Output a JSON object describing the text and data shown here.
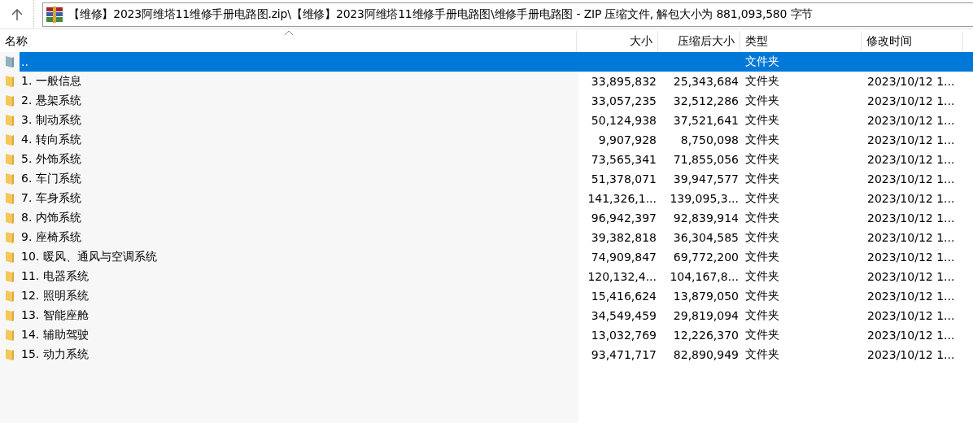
{
  "address_bar": {
    "path": "【维修】2023阿维塔11维修手册电路图.zip\\【维修】2023阿维塔11维修手册电路图\\维修手册电路图 - ZIP 压缩文件, 解包大小为 881,093,580 字节"
  },
  "table": {
    "columns": [
      {
        "label": "名称",
        "sorted": true
      },
      {
        "label": "大小",
        "sorted": false
      },
      {
        "label": "压缩后大小",
        "sorted": false
      },
      {
        "label": "类型",
        "sorted": false
      },
      {
        "label": "修改时间",
        "sorted": false
      }
    ],
    "rows": [
      {
        "kind": "parent",
        "name": "..",
        "type": "文件夹",
        "selected": true
      },
      {
        "kind": "folder",
        "name": "1. 一般信息",
        "size": "33,895,832",
        "packed": "25,343,684",
        "type": "文件夹",
        "modified": "2023/10/12 1...",
        "selected": false
      },
      {
        "kind": "folder",
        "name": "2. 悬架系统",
        "size": "33,057,235",
        "packed": "32,512,286",
        "type": "文件夹",
        "modified": "2023/10/12 1...",
        "selected": false
      },
      {
        "kind": "folder",
        "name": "3. 制动系统",
        "size": "50,124,938",
        "packed": "37,521,641",
        "type": "文件夹",
        "modified": "2023/10/12 1...",
        "selected": false
      },
      {
        "kind": "folder",
        "name": "4. 转向系统",
        "size": "9,907,928",
        "packed": "8,750,098",
        "type": "文件夹",
        "modified": "2023/10/12 1...",
        "selected": false
      },
      {
        "kind": "folder",
        "name": "5. 外饰系统",
        "size": "73,565,341",
        "packed": "71,855,056",
        "type": "文件夹",
        "modified": "2023/10/12 1...",
        "selected": false
      },
      {
        "kind": "folder",
        "name": "6. 车门系统",
        "size": "51,378,071",
        "packed": "39,947,577",
        "type": "文件夹",
        "modified": "2023/10/12 1...",
        "selected": false
      },
      {
        "kind": "folder",
        "name": "7. 车身系统",
        "size": "141,326,1...",
        "packed": "139,095,3...",
        "type": "文件夹",
        "modified": "2023/10/12 1...",
        "selected": false
      },
      {
        "kind": "folder",
        "name": "8. 内饰系统",
        "size": "96,942,397",
        "packed": "92,839,914",
        "type": "文件夹",
        "modified": "2023/10/12 1...",
        "selected": false
      },
      {
        "kind": "folder",
        "name": "9. 座椅系统",
        "size": "39,382,818",
        "packed": "36,304,585",
        "type": "文件夹",
        "modified": "2023/10/12 1...",
        "selected": false
      },
      {
        "kind": "folder",
        "name": "10. 暖风、通风与空调系统",
        "size": "74,909,847",
        "packed": "69,772,200",
        "type": "文件夹",
        "modified": "2023/10/12 1...",
        "selected": false
      },
      {
        "kind": "folder",
        "name": "11. 电器系统",
        "size": "120,132,4...",
        "packed": "104,167,8...",
        "type": "文件夹",
        "modified": "2023/10/12 1...",
        "selected": false
      },
      {
        "kind": "folder",
        "name": "12. 照明系统",
        "size": "15,416,624",
        "packed": "13,879,050",
        "type": "文件夹",
        "modified": "2023/10/12 1...",
        "selected": false
      },
      {
        "kind": "folder",
        "name": "13. 智能座舱",
        "size": "34,549,459",
        "packed": "29,819,094",
        "type": "文件夹",
        "modified": "2023/10/12 1...",
        "selected": false
      },
      {
        "kind": "folder",
        "name": "14. 辅助驾驶",
        "size": "13,032,769",
        "packed": "12,226,370",
        "type": "文件夹",
        "modified": "2023/10/12 1...",
        "selected": false
      },
      {
        "kind": "folder",
        "name": "15. 动力系统",
        "size": "93,471,717",
        "packed": "82,890,949",
        "type": "文件夹",
        "modified": "2023/10/12 1...",
        "selected": false
      }
    ]
  }
}
